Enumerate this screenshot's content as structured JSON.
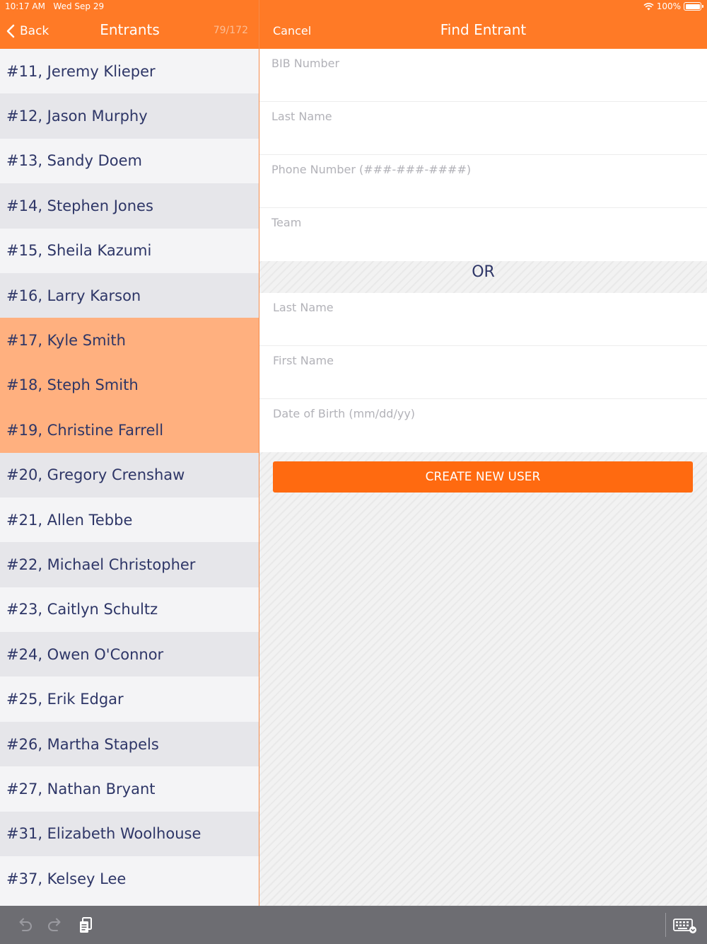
{
  "status_bar": {
    "time": "10:17 AM",
    "date": "Wed Sep 29",
    "battery": "100%"
  },
  "left": {
    "back_label": "Back",
    "title": "Entrants",
    "count": "79/172",
    "entrants": [
      {
        "label": "#11, Jeremy Klieper",
        "selected": false
      },
      {
        "label": "#12, Jason Murphy",
        "selected": false
      },
      {
        "label": "#13, Sandy Doem",
        "selected": false
      },
      {
        "label": "#14, Stephen Jones",
        "selected": false
      },
      {
        "label": "#15, Sheila Kazumi",
        "selected": false
      },
      {
        "label": "#16, Larry Karson",
        "selected": false
      },
      {
        "label": "#17, Kyle Smith",
        "selected": true
      },
      {
        "label": "#18, Steph Smith",
        "selected": true
      },
      {
        "label": "#19, Christine Farrell",
        "selected": true
      },
      {
        "label": "#20, Gregory Crenshaw",
        "selected": false
      },
      {
        "label": "#21, Allen Tebbe",
        "selected": false
      },
      {
        "label": "#22, Michael Christopher",
        "selected": false
      },
      {
        "label": "#23, Caitlyn Schultz",
        "selected": false
      },
      {
        "label": "#24, Owen O'Connor",
        "selected": false
      },
      {
        "label": "#25, Erik Edgar",
        "selected": false
      },
      {
        "label": "#26, Martha Stapels",
        "selected": false
      },
      {
        "label": "#27, Nathan Bryant",
        "selected": false
      },
      {
        "label": "#31, Elizabeth Woolhouse",
        "selected": false
      },
      {
        "label": "#37, Kelsey Lee",
        "selected": false
      }
    ]
  },
  "right": {
    "cancel_label": "Cancel",
    "title": "Find Entrant",
    "group1": {
      "bib_placeholder": "BIB Number",
      "last_name_placeholder": "Last Name",
      "phone_placeholder": "Phone Number (###-###-####)",
      "team_placeholder": "Team"
    },
    "or_label": "OR",
    "group2": {
      "last_name_placeholder": "Last Name",
      "first_name_placeholder": "First Name",
      "dob_placeholder": "Date of Birth (mm/dd/yy)"
    },
    "create_button": "CREATE NEW USER"
  },
  "colors": {
    "accent": "#ff7a26",
    "button": "#ff6a10",
    "selected_row": "#ffb07f",
    "text": "#2e3667"
  },
  "icons": [
    "chevron-left-icon",
    "wifi-icon",
    "battery-icon",
    "undo-icon",
    "redo-icon",
    "paste-icon",
    "keyboard-icon"
  ]
}
